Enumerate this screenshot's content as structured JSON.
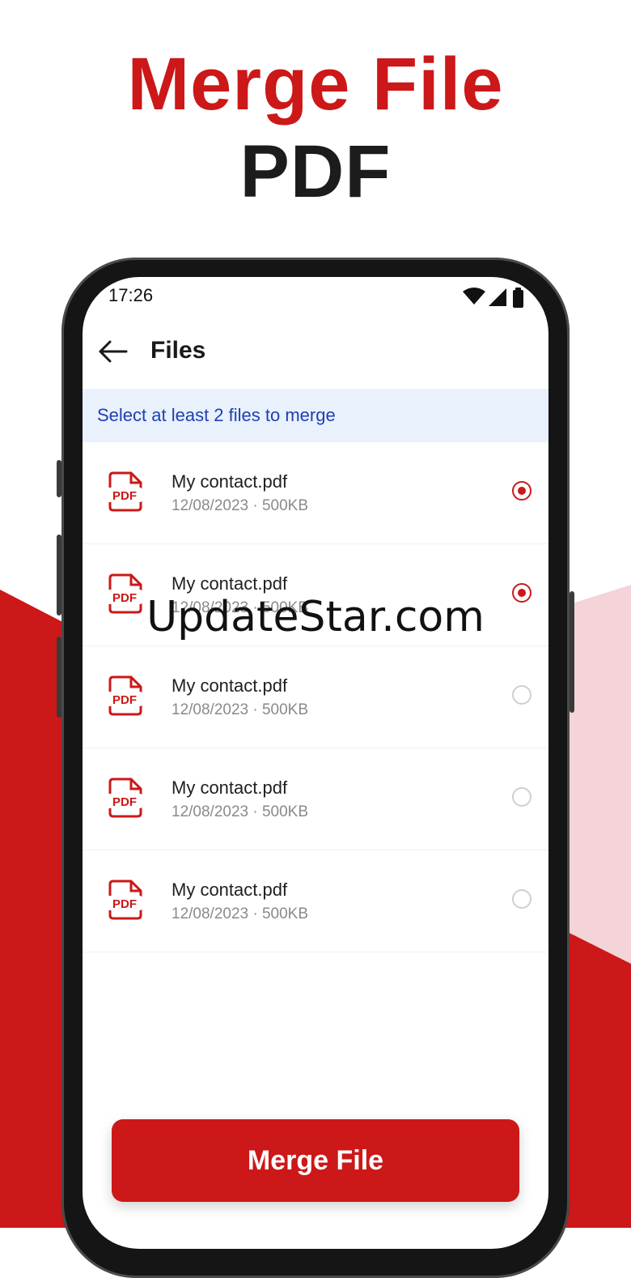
{
  "headline": {
    "line1": "Merge File",
    "line2": "PDF"
  },
  "colors": {
    "brand_red": "#cc1818",
    "dark_text": "#1c1c1c",
    "banner_bg": "#e8f1fc",
    "banner_text": "#1f3fb3",
    "pink_shape": "#f4d4d8"
  },
  "status_bar": {
    "time": "17:26",
    "icons": [
      "wifi-icon",
      "signal-icon",
      "battery-icon"
    ]
  },
  "app_bar": {
    "back_icon": "arrow-left-icon",
    "title": "Files"
  },
  "banner": {
    "text": "Select at least 2 files to merge"
  },
  "files": [
    {
      "name": "My contact.pdf",
      "meta": "12/08/2023 · 500KB",
      "selected": true
    },
    {
      "name": "My contact.pdf",
      "meta": "12/08/2023 · 500KB",
      "selected": true
    },
    {
      "name": "My contact.pdf",
      "meta": "12/08/2023 · 500KB",
      "selected": false
    },
    {
      "name": "My contact.pdf",
      "meta": "12/08/2023 · 500KB",
      "selected": false
    },
    {
      "name": "My contact.pdf",
      "meta": "12/08/2023 · 500KB",
      "selected": false
    }
  ],
  "file_icon": "pdf-file-icon",
  "merge_button": {
    "label": "Merge File"
  },
  "watermark": "UpdateStar.com"
}
